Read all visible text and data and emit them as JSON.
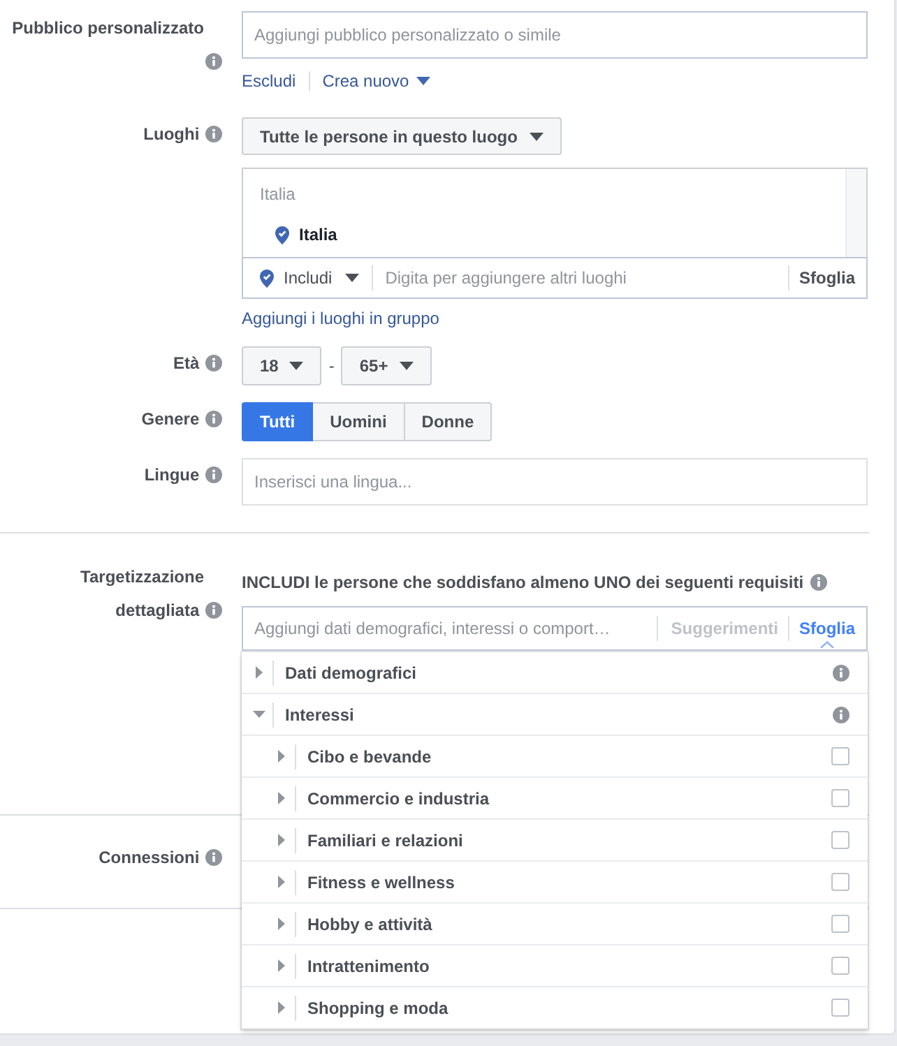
{
  "custom_audience": {
    "label": "Pubblico personalizzato",
    "placeholder": "Aggiungi pubblico personalizzato o simile",
    "links": [
      {
        "label": "Escludi",
        "kind": "link"
      },
      {
        "label": "Crea nuovo",
        "kind": "menu"
      }
    ]
  },
  "locations": {
    "label": "Luoghi",
    "mode": "Tutte le persone in questo luogo",
    "groups": [
      {
        "heading": "Italia",
        "items": [
          {
            "name": "Italia"
          }
        ]
      }
    ],
    "include": "Includi",
    "placeholder": "Digita per aggiungere altri luoghi",
    "browse": "Sfoglia",
    "bulk_link": "Aggiungi i luoghi in gruppo"
  },
  "age": {
    "label": "Età",
    "from": "18",
    "separator": "-",
    "to": "65+"
  },
  "gender": {
    "label": "Genere",
    "options": [
      {
        "label": "Tutti",
        "selected": true
      },
      {
        "label": "Uomini",
        "selected": false
      },
      {
        "label": "Donne",
        "selected": false
      }
    ]
  },
  "languages": {
    "label": "Lingue",
    "placeholder": "Inserisci una lingua..."
  },
  "detailed_targeting": {
    "label": "Targetizzazione dettagliata",
    "heading": "INCLUDI le persone che soddisfano almeno UNO dei seguenti requisiti",
    "placeholder": "Aggiungi dati demografici, interessi o comport…",
    "tabs": [
      {
        "label": "Suggerimenti",
        "selected": false
      },
      {
        "label": "Sfoglia",
        "selected": true
      }
    ],
    "categories": [
      {
        "label": "Dati demografici",
        "kind": "category",
        "expanded": false
      },
      {
        "label": "Interessi",
        "kind": "category",
        "expanded": true,
        "children": [
          {
            "label": "Cibo e bevande",
            "kind": "option",
            "expanded": false,
            "checked": false
          },
          {
            "label": "Commercio e industria",
            "kind": "option",
            "expanded": false,
            "checked": false
          },
          {
            "label": "Familiari e relazioni",
            "kind": "option",
            "expanded": false,
            "checked": false
          },
          {
            "label": "Fitness e wellness",
            "kind": "option",
            "expanded": false,
            "checked": false
          },
          {
            "label": "Hobby e attività",
            "kind": "option",
            "expanded": false,
            "checked": false
          },
          {
            "label": "Intrattenimento",
            "kind": "option",
            "expanded": false,
            "checked": false
          },
          {
            "label": "Shopping e moda",
            "kind": "option",
            "expanded": false,
            "checked": false
          }
        ]
      }
    ]
  },
  "connections": {
    "label": "Connessioni"
  }
}
